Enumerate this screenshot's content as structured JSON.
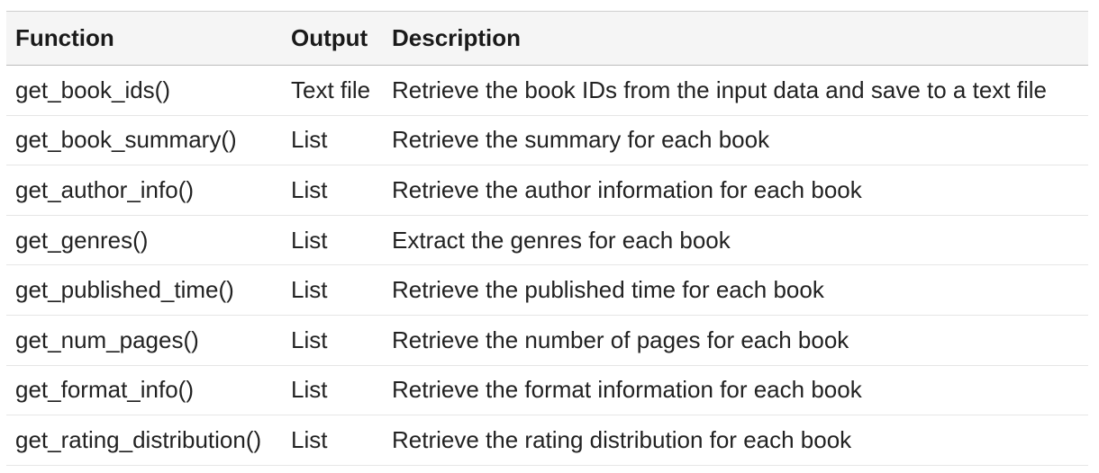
{
  "table": {
    "headers": {
      "function": "Function",
      "output": "Output",
      "description": "Description"
    },
    "rows": [
      {
        "function": "get_book_ids()",
        "output": "Text file",
        "description": "Retrieve the book IDs from the input data and save to a text file"
      },
      {
        "function": "get_book_summary()",
        "output": "List",
        "description": "Retrieve the summary for each book"
      },
      {
        "function": "get_author_info()",
        "output": "List",
        "description": "Retrieve the author information for each book"
      },
      {
        "function": "get_genres()",
        "output": "List",
        "description": "Extract the genres for each book"
      },
      {
        "function": "get_published_time()",
        "output": "List",
        "description": "Retrieve the published time for each book"
      },
      {
        "function": "get_num_pages()",
        "output": "List",
        "description": "Retrieve the number of pages for each book"
      },
      {
        "function": "get_format_info()",
        "output": "List",
        "description": "Retrieve the format information for each book"
      },
      {
        "function": "get_rating_distribution()",
        "output": "List",
        "description": "Retrieve the rating distribution for each book"
      }
    ]
  }
}
